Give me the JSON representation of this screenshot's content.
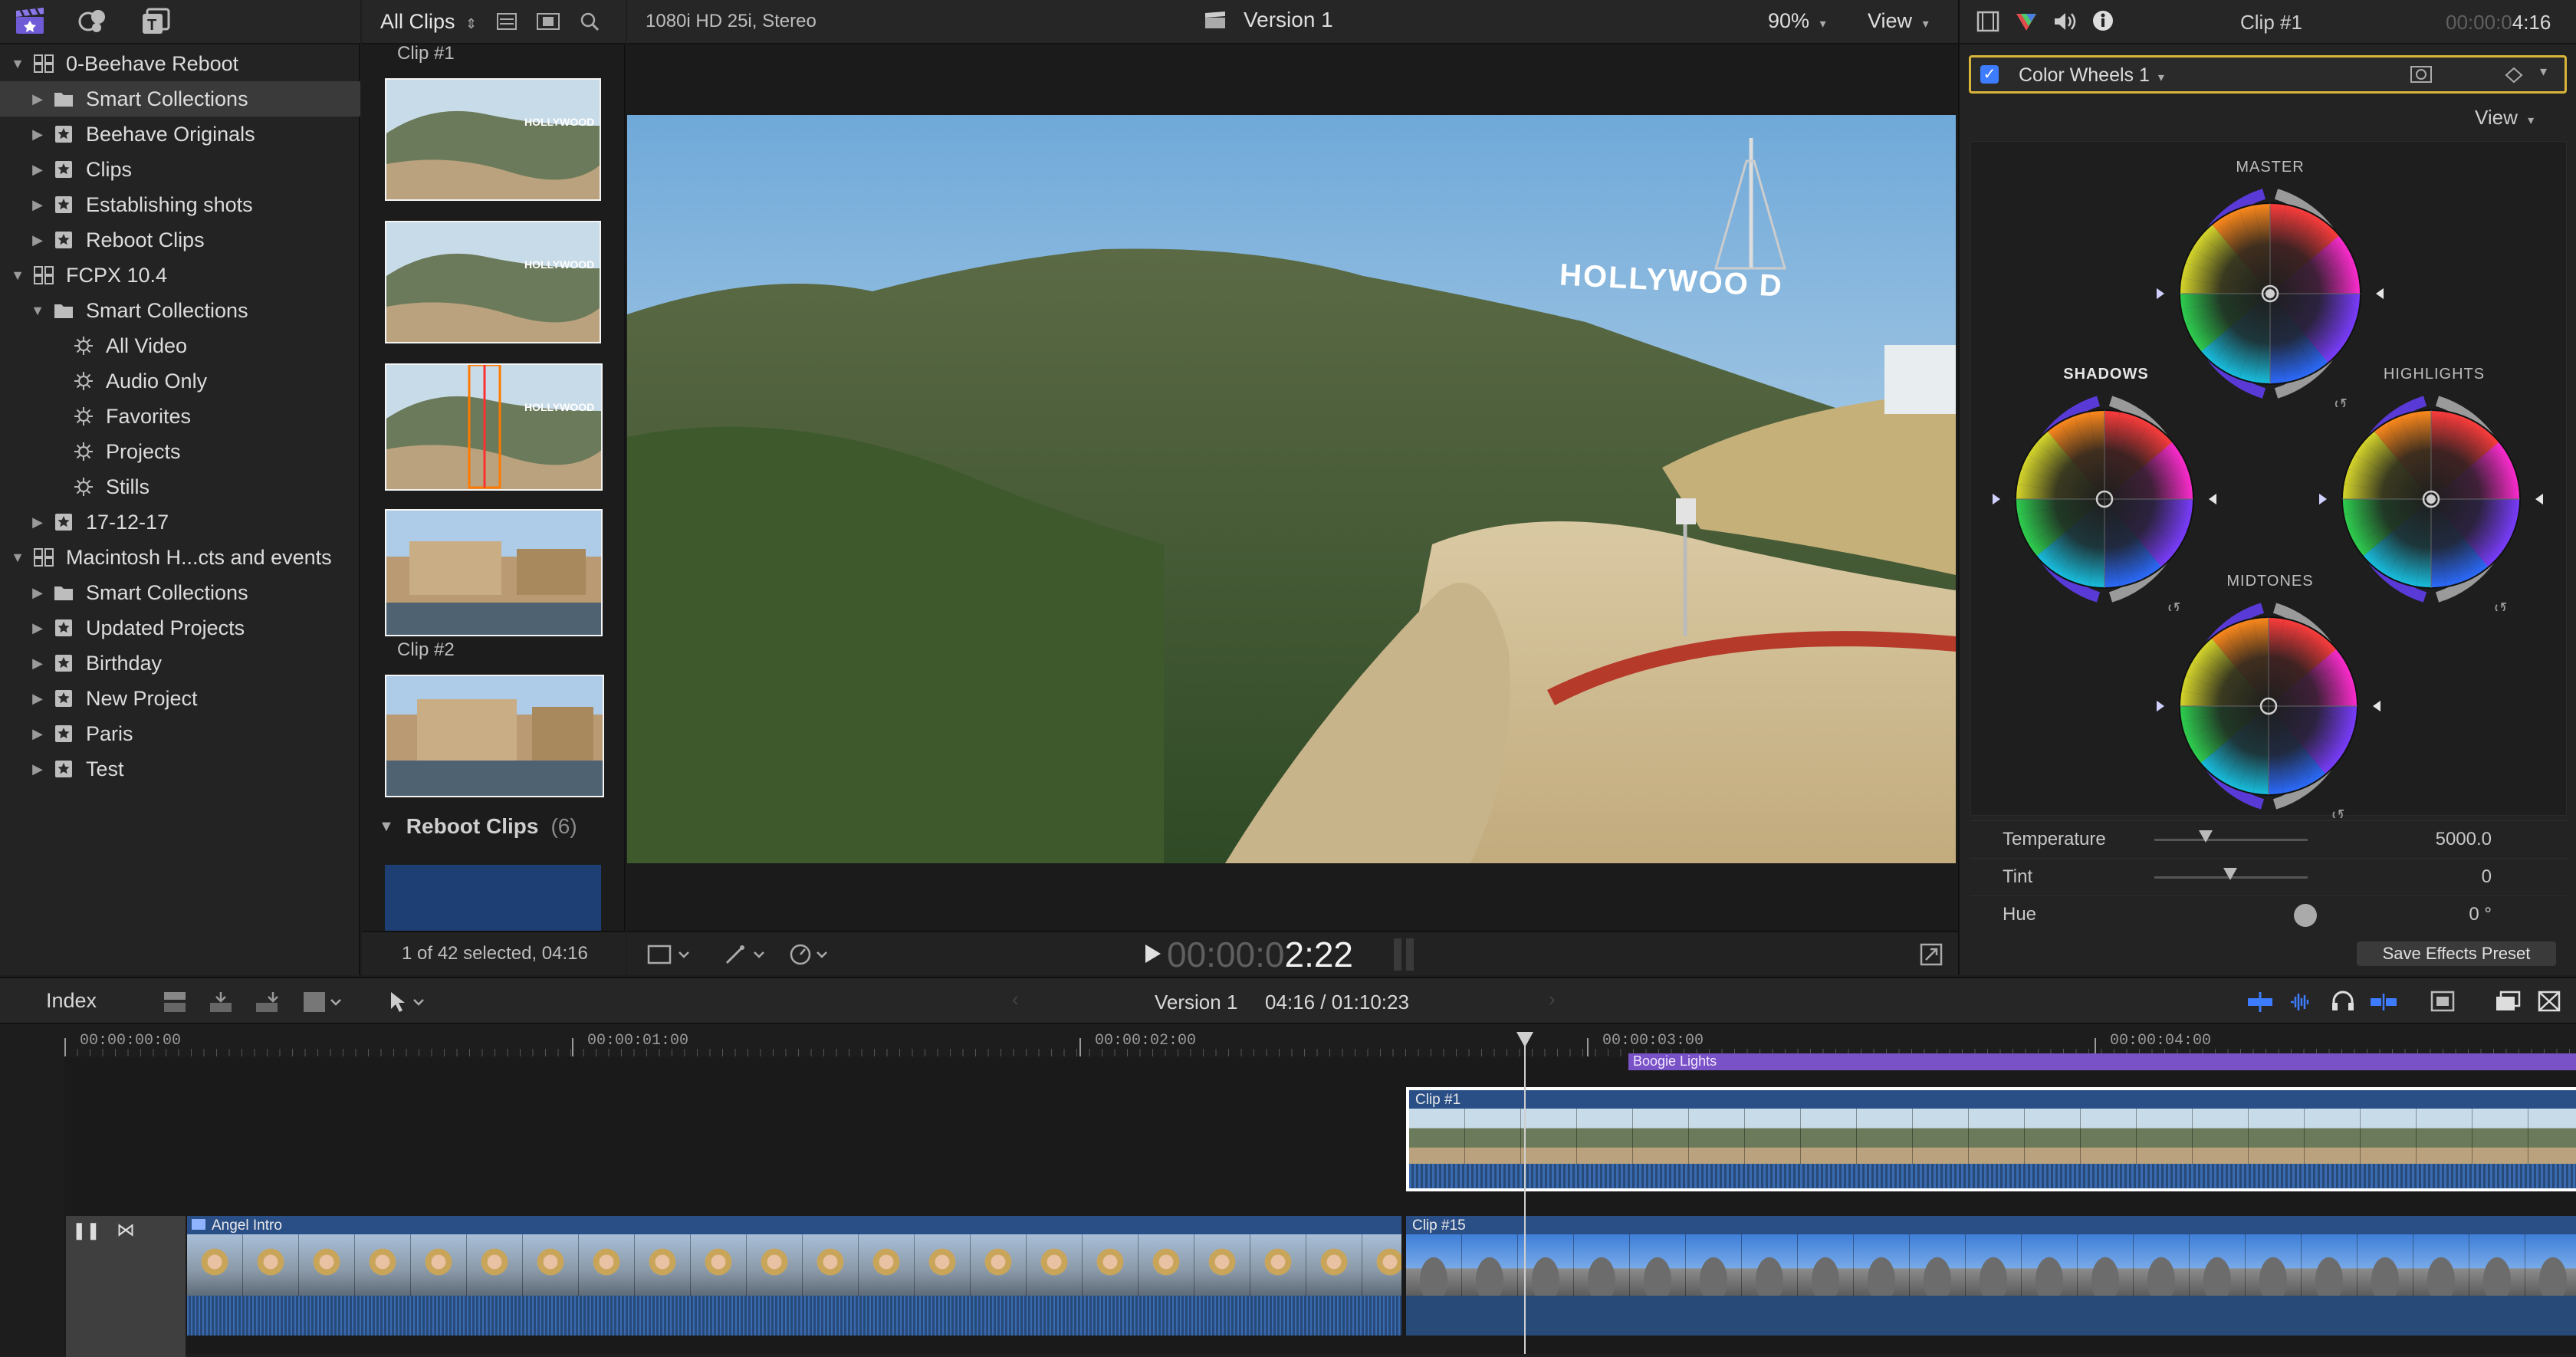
{
  "toolbar_left": {
    "icons": [
      "clapper-library-icon",
      "photos-music-icon",
      "titles-icon"
    ]
  },
  "sidebar": {
    "rows": [
      {
        "label": "0-Beehave Reboot",
        "level": 0,
        "expanded": true,
        "icon": "library-icon",
        "selected": false
      },
      {
        "label": "Smart Collections",
        "level": 1,
        "expanded": false,
        "icon": "folder-icon",
        "selected": true
      },
      {
        "label": "Beehave Originals",
        "level": 1,
        "expanded": false,
        "icon": "event-star-icon",
        "selected": false
      },
      {
        "label": "Clips",
        "level": 1,
        "expanded": false,
        "icon": "event-star-icon",
        "selected": false
      },
      {
        "label": "Establishing shots",
        "level": 1,
        "expanded": false,
        "icon": "event-star-icon",
        "selected": false
      },
      {
        "label": "Reboot Clips",
        "level": 1,
        "expanded": false,
        "icon": "event-star-icon",
        "selected": false
      },
      {
        "label": "FCPX 10.4",
        "level": 0,
        "expanded": true,
        "icon": "library-icon",
        "selected": false
      },
      {
        "label": "Smart Collections",
        "level": 1,
        "expanded": true,
        "icon": "folder-icon",
        "selected": false
      },
      {
        "label": "All Video",
        "level": 2,
        "expanded": null,
        "icon": "smart-gear-icon",
        "selected": false
      },
      {
        "label": "Audio Only",
        "level": 2,
        "expanded": null,
        "icon": "smart-gear-icon",
        "selected": false
      },
      {
        "label": "Favorites",
        "level": 2,
        "expanded": null,
        "icon": "smart-gear-icon",
        "selected": false
      },
      {
        "label": "Projects",
        "level": 2,
        "expanded": null,
        "icon": "smart-gear-icon",
        "selected": false
      },
      {
        "label": "Stills",
        "level": 2,
        "expanded": null,
        "icon": "smart-gear-icon",
        "selected": false
      },
      {
        "label": "17-12-17",
        "level": 1,
        "expanded": false,
        "icon": "event-star-icon",
        "selected": false
      },
      {
        "label": "Macintosh H...cts and events",
        "level": 0,
        "expanded": true,
        "icon": "library-icon",
        "selected": false
      },
      {
        "label": "Smart Collections",
        "level": 1,
        "expanded": false,
        "icon": "folder-icon",
        "selected": false
      },
      {
        "label": "Updated Projects",
        "level": 1,
        "expanded": false,
        "icon": "event-star-icon",
        "selected": false
      },
      {
        "label": "Birthday",
        "level": 1,
        "expanded": false,
        "icon": "event-star-icon",
        "selected": false
      },
      {
        "label": "New Project",
        "level": 1,
        "expanded": false,
        "icon": "event-star-icon",
        "selected": false
      },
      {
        "label": "Paris",
        "level": 1,
        "expanded": false,
        "icon": "event-star-icon",
        "selected": false
      },
      {
        "label": "Test",
        "level": 1,
        "expanded": false,
        "icon": "event-star-icon",
        "selected": false
      }
    ]
  },
  "browser": {
    "filter_label": "All Clips",
    "clip1_label": "Clip #1",
    "clip2_label": "Clip #2",
    "group_label": "Reboot Clips",
    "group_count": "(6)",
    "status": "1 of 42 selected, 04:16"
  },
  "viewer": {
    "format": "1080i HD 25i, Stereo",
    "project": "Version 1",
    "zoom": "90%",
    "view_label": "View",
    "timecode_dim": "00:00:0",
    "timecode_bright": "2:22",
    "sign_text": "HOLLYWOO D"
  },
  "inspector": {
    "title": "Clip #1",
    "duration_dim": "00:00:0",
    "duration_bright": "4:16",
    "effect_name": "Color Wheels 1",
    "view_label": "View",
    "wheels": {
      "master": "MASTER",
      "shadows": "SHADOWS",
      "highlights": "HIGHLIGHTS",
      "midtones": "MIDTONES"
    },
    "params": [
      {
        "label": "Temperature",
        "value": "5000.0"
      },
      {
        "label": "Tint",
        "value": "0"
      },
      {
        "label": "Hue",
        "value": "0 °"
      }
    ],
    "save_preset": "Save Effects Preset"
  },
  "timeline_bar": {
    "index_label": "Index",
    "project": "Version 1",
    "position": "04:16 / 01:10:23"
  },
  "timeline": {
    "ruler": [
      "00:00:00:00",
      "00:00:01:00",
      "00:00:02:00",
      "00:00:03:00",
      "00:00:04:00"
    ],
    "title_clip": "Boogie Lights",
    "clip_a": "Clip #1",
    "clip_b": "Angel Intro",
    "clip_c": "Clip #15"
  },
  "colors": {
    "accent_blue": "#3d7cff",
    "effect_border": "#d9b43a",
    "title_purple": "#7a52c7",
    "audio_blue": "#284a78"
  }
}
